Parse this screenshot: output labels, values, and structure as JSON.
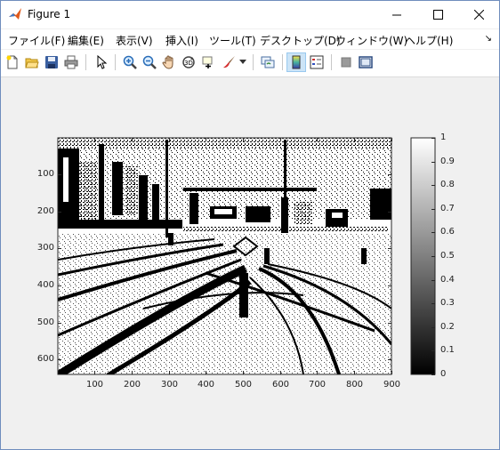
{
  "window": {
    "title": "Figure 1",
    "icon": "matlab-icon"
  },
  "menu": [
    "ファイル(F)",
    "編集(E)",
    "表示(V)",
    "挿入(I)",
    "ツール(T)",
    "デスクトップ(D)",
    "ウィンドウ(W)",
    "ヘルプ(H)"
  ],
  "toolbar": {
    "icons": [
      "new-figure-icon",
      "open-file-icon",
      "save-icon",
      "print-icon",
      "pointer-icon",
      "zoom-in-icon",
      "zoom-out-icon",
      "pan-icon",
      "rotate-3d-icon",
      "data-cursor-icon",
      "brush-icon",
      "brush-dropdown-icon",
      "link-plot-icon",
      "colorbar-icon",
      "legend-icon",
      "hide-plot-tools-icon",
      "show-plot-tools-icon"
    ],
    "active": [
      "colorbar-icon"
    ]
  },
  "chart_data": [
    {
      "type": "heatmap",
      "description_kind": "binary image (thresholded grayscale)",
      "colormap": "gray",
      "xlim": [
        0.5,
        900.5
      ],
      "ylim": [
        0.5,
        640.5
      ],
      "x_ticks": [
        100,
        200,
        300,
        400,
        500,
        600,
        700,
        800,
        900
      ],
      "y_ticks": [
        100,
        200,
        300,
        400,
        500,
        600
      ],
      "y_direction": "reverse",
      "grid": false,
      "title": "",
      "xlabel": "",
      "ylabel": ""
    },
    {
      "type": "colorbar",
      "limits": [
        0,
        1
      ],
      "ticks": [
        0,
        0.1,
        0.2,
        0.3,
        0.4,
        0.5,
        0.6,
        0.7,
        0.8,
        0.9,
        1
      ],
      "tick_labels": [
        "0",
        "0.1",
        "0.2",
        "0.3",
        "0.4",
        "0.5",
        "0.6",
        "0.7",
        "0.8",
        "0.9",
        "1"
      ],
      "placement": "right"
    }
  ]
}
